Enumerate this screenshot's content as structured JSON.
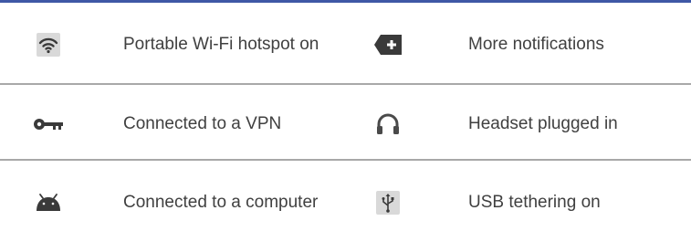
{
  "rows": [
    {
      "left": {
        "icon": "wifi-hotspot-icon",
        "label": "Portable Wi-Fi hotspot on"
      },
      "right": {
        "icon": "more-notifications-icon",
        "label": "More notifications"
      }
    },
    {
      "left": {
        "icon": "vpn-key-icon",
        "label": "Connected to a VPN"
      },
      "right": {
        "icon": "headset-icon",
        "label": "Headset plugged in"
      }
    },
    {
      "left": {
        "icon": "android-computer-icon",
        "label": "Connected to a computer"
      },
      "right": {
        "icon": "usb-icon",
        "label": "USB tethering on"
      }
    }
  ],
  "colors": {
    "top_rule": "#3f58a6",
    "divider": "#a8a8a8",
    "icon_gray": "#4a4a4a"
  }
}
